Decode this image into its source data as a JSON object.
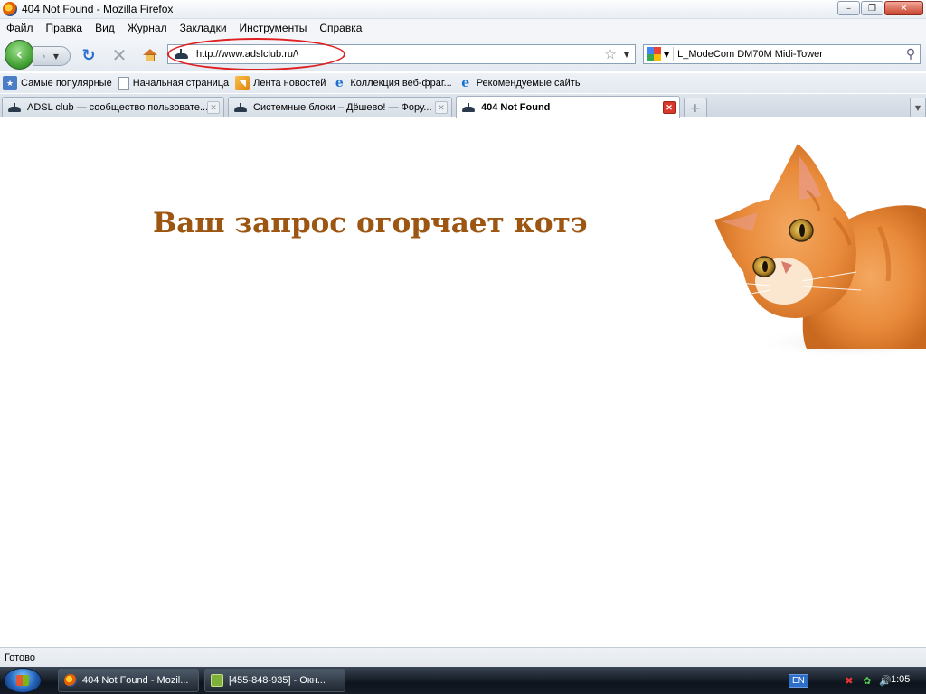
{
  "window": {
    "title": "404 Not Found - Mozilla Firefox",
    "buttons": {
      "minimize": "–",
      "maximize": "❐",
      "close": "✕"
    }
  },
  "menu": [
    "Файл",
    "Правка",
    "Вид",
    "Журнал",
    "Закладки",
    "Инструменты",
    "Справка"
  ],
  "nav": {
    "url": "http://www.adslclub.ru/\\",
    "search_query": "L_ModeCom DM70M Midi-Tower",
    "icons": {
      "back": "back-arrow-icon",
      "forward": "forward-arrow-icon",
      "reload": "reload-icon",
      "stop": "stop-icon",
      "home": "home-icon"
    }
  },
  "bookmarks": [
    {
      "label": "Самые популярные",
      "icon": "popular"
    },
    {
      "label": "Начальная страница",
      "icon": "page"
    },
    {
      "label": "Лента новостей",
      "icon": "rss"
    },
    {
      "label": "Коллекция веб-фраг...",
      "icon": "ie"
    },
    {
      "label": "Рекомендуемые сайты",
      "icon": "ie"
    }
  ],
  "tabs": [
    {
      "label": "ADSL club — сообщество пользовате...",
      "active": false
    },
    {
      "label": "Системные блоки – Дёшево! — Фору...",
      "active": false
    },
    {
      "label": "404 Not Found",
      "active": true
    }
  ],
  "page": {
    "headline": "Ваш запрос огорчает котэ",
    "image": "orange-cat"
  },
  "status": "Готово",
  "taskbar": {
    "tasks": [
      "404 Not Found - Mozil...",
      "[455-848-935] - Окн..."
    ],
    "lang": "EN",
    "clock": "1:05"
  },
  "colors": {
    "headline": "#9c5612",
    "annotation": "#e02020"
  }
}
